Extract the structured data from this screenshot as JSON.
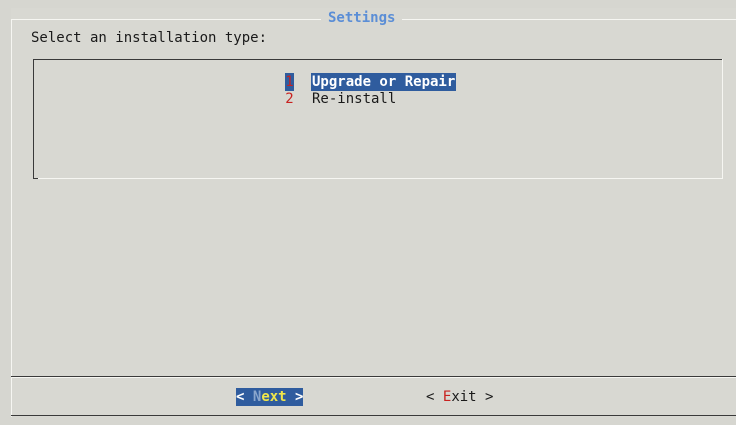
{
  "dialog": {
    "title": "Settings",
    "prompt": "Select an installation type:"
  },
  "menu": {
    "items": [
      {
        "tag": "1",
        "label": "Upgrade or Repair",
        "selected": true
      },
      {
        "tag": "2",
        "label": "Re-install",
        "selected": false
      }
    ]
  },
  "buttons": {
    "next": {
      "left": "<",
      "hotkey": "N",
      "rest": "ext",
      "right": ">"
    },
    "exit": {
      "left": "<",
      "hotkey": "E",
      "rest": "xit",
      "right": ">"
    }
  },
  "colors": {
    "background": "#d8d8d2",
    "title": "#5b8ed6",
    "selection": "#2f5c9e",
    "hotkey": "#c8211f",
    "button_focus_text": "#f0e64a"
  }
}
